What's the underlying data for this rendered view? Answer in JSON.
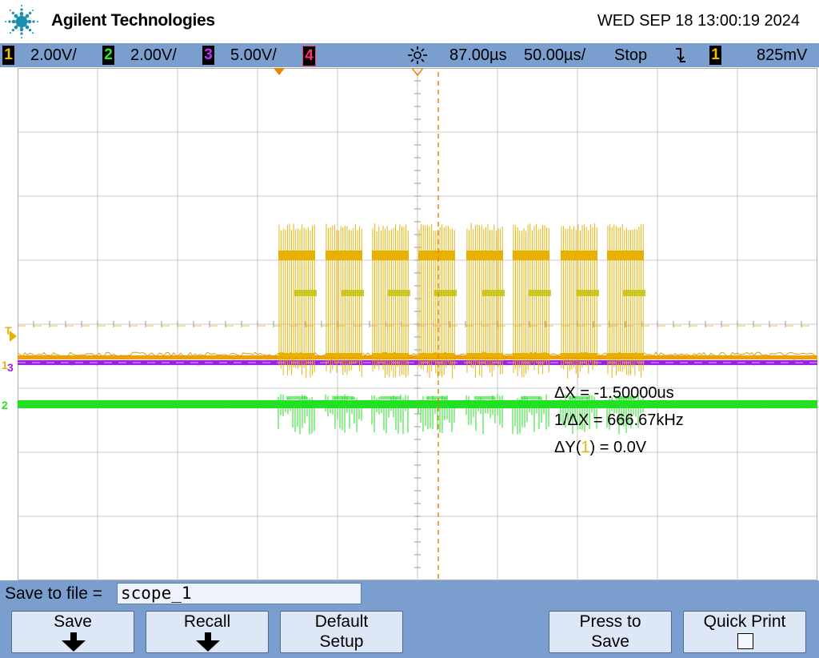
{
  "header": {
    "brand": "Agilent Technologies",
    "datetime": "WED SEP 18 13:00:19 2024",
    "logo_icon": "agilent-spark-icon"
  },
  "status": {
    "ch1": {
      "num": "1",
      "scale": "2.00V/"
    },
    "ch2": {
      "num": "2",
      "scale": "2.00V/"
    },
    "ch3": {
      "num": "3",
      "scale": "5.00V/"
    },
    "ch4": {
      "num": "4"
    },
    "time_position": "87.00µs",
    "time_scale": "50.00µs/",
    "run_state": "Stop",
    "trigger_slope_icon": "falling-edge-icon",
    "trigger_source": "1",
    "trigger_level": "825mV"
  },
  "markers": {
    "trigger": "T",
    "ch1": "1",
    "ch3": "3",
    "ch2": "2"
  },
  "measurements": {
    "dx_label": "ΔX = ",
    "dx_value": "-1.50000us",
    "inv_dx_label": "1/ΔX = ",
    "inv_dx_value": "666.67kHz",
    "dy_prefix": "ΔY(",
    "dy_channel": "1",
    "dy_suffix": ") = 0.0V"
  },
  "colors": {
    "ch1": "#e8b000",
    "ch2": "#22e022",
    "ch3": "#a020e0",
    "ch4": "#ff3070",
    "panel": "#7a9fcf",
    "grid": "#c8c8c8"
  },
  "bottom": {
    "save_to_file_label": "Save to file =",
    "file_name": "scope_1",
    "softkeys": {
      "save": "Save",
      "recall": "Recall",
      "default_l1": "Default",
      "default_l2": "Setup",
      "press_l1": "Press to",
      "press_l2": "Save",
      "quick_print": "Quick Print"
    }
  }
}
